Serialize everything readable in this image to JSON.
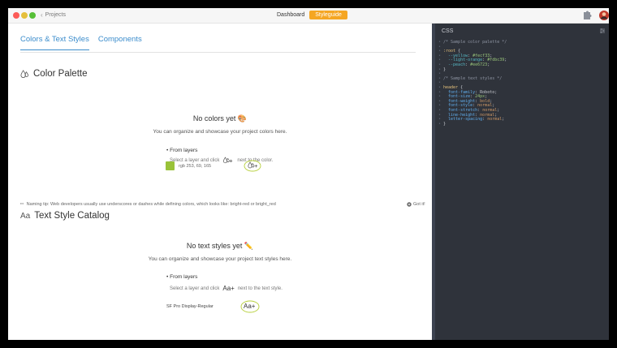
{
  "titlebar": {
    "back_label": "Projects",
    "tabs": [
      {
        "label": "Dashboard",
        "active": false
      },
      {
        "label": "Styleguide",
        "active": true
      }
    ]
  },
  "main": {
    "tabs": [
      {
        "label": "Colors & Text Styles",
        "active": true
      },
      {
        "label": "Components",
        "active": false
      }
    ],
    "color_section": {
      "title": "Color Palette",
      "empty_title": "No colors yet 🎨",
      "empty_sub": "You can organize and showcase your project colors here.",
      "from_layers": "From layers",
      "hint_before": "Select a layer and click",
      "hint_after": "next to the color.",
      "swatch_label": "rgb 253, 69, 165",
      "swatch_color": "#99c239"
    },
    "tip": {
      "text": "Naming tip: Web developers usually use underscores or dashes while defining colors, which looks like: bright-red or bright_red",
      "dismiss": "Got it!"
    },
    "text_section": {
      "title": "Text Style Catalog",
      "title_icon": "Aa",
      "empty_title": "No text styles yet ✏️",
      "empty_sub": "You can organize and showcase your project text styles here.",
      "from_layers": "From layers",
      "hint_before": "Select a layer and click",
      "hint_icon": "Aa+",
      "hint_after": "next to the text style.",
      "font_label": "SF Pro Display-Regular",
      "add_button": "Aa+"
    }
  },
  "panel": {
    "title": "CSS",
    "lines": [
      [
        [
          "c-comment",
          "/* Sample color palette */"
        ]
      ],
      [
        [
          "c-plain",
          ""
        ]
      ],
      [
        [
          "c-sel",
          ":root"
        ],
        [
          "c-plain",
          " {"
        ]
      ],
      [
        [
          "c-var",
          "  --yellow"
        ],
        [
          "c-plain",
          ": "
        ],
        [
          "c-num",
          "#fecf33"
        ],
        [
          "c-plain",
          ";"
        ]
      ],
      [
        [
          "c-var",
          "  --light-orange"
        ],
        [
          "c-plain",
          ": "
        ],
        [
          "c-num",
          "#fdbc39"
        ],
        [
          "c-plain",
          ";"
        ]
      ],
      [
        [
          "c-var",
          "  --peach"
        ],
        [
          "c-plain",
          ": "
        ],
        [
          "c-num",
          "#ee6723"
        ],
        [
          "c-plain",
          ";"
        ]
      ],
      [
        [
          "c-plain",
          "}"
        ]
      ],
      [
        [
          "c-plain",
          ""
        ]
      ],
      [
        [
          "c-comment",
          "/* Sample text styles */"
        ]
      ],
      [
        [
          "c-plain",
          ""
        ]
      ],
      [
        [
          "c-sel",
          "header"
        ],
        [
          "c-plain",
          " {"
        ]
      ],
      [
        [
          "c-prop",
          "  font-family"
        ],
        [
          "c-plain",
          ": Roboto;"
        ]
      ],
      [
        [
          "c-prop",
          "  font-size"
        ],
        [
          "c-plain",
          ": "
        ],
        [
          "c-num",
          "24px"
        ],
        [
          "c-plain",
          ";"
        ]
      ],
      [
        [
          "c-prop",
          "  font-weight"
        ],
        [
          "c-plain",
          ": "
        ],
        [
          "c-val",
          "bold"
        ],
        [
          "c-plain",
          ";"
        ]
      ],
      [
        [
          "c-prop",
          "  font-style"
        ],
        [
          "c-plain",
          ": "
        ],
        [
          "c-val",
          "normal"
        ],
        [
          "c-plain",
          ";"
        ]
      ],
      [
        [
          "c-prop",
          "  font-stretch"
        ],
        [
          "c-plain",
          ": "
        ],
        [
          "c-val",
          "normal"
        ],
        [
          "c-plain",
          ";"
        ]
      ],
      [
        [
          "c-prop",
          "  line-height"
        ],
        [
          "c-plain",
          ": "
        ],
        [
          "c-val",
          "normal"
        ],
        [
          "c-plain",
          ";"
        ]
      ],
      [
        [
          "c-prop",
          "  letter-spacing"
        ],
        [
          "c-plain",
          ": "
        ],
        [
          "c-val",
          "normal"
        ],
        [
          "c-plain",
          ";"
        ]
      ],
      [
        [
          "c-plain",
          "}"
        ]
      ]
    ]
  }
}
